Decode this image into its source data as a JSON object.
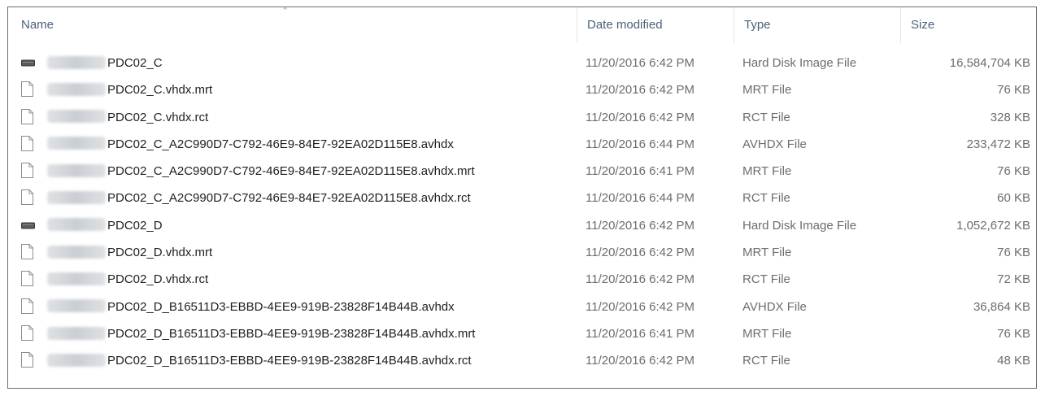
{
  "columns": {
    "name": "Name",
    "date": "Date modified",
    "type": "Type",
    "size": "Size"
  },
  "files": [
    {
      "icon": "hard-disk-icon",
      "name": "PDC02_C",
      "date": "11/20/2016 6:42 PM",
      "type": "Hard Disk Image File",
      "size": "16,584,704 KB"
    },
    {
      "icon": "document-icon",
      "name": "PDC02_C.vhdx.mrt",
      "date": "11/20/2016 6:42 PM",
      "type": "MRT File",
      "size": "76 KB"
    },
    {
      "icon": "document-icon",
      "name": "PDC02_C.vhdx.rct",
      "date": "11/20/2016 6:42 PM",
      "type": "RCT File",
      "size": "328 KB"
    },
    {
      "icon": "document-icon",
      "name": "PDC02_C_A2C990D7-C792-46E9-84E7-92EA02D115E8.avhdx",
      "date": "11/20/2016 6:44 PM",
      "type": "AVHDX File",
      "size": "233,472 KB"
    },
    {
      "icon": "document-icon",
      "name": "PDC02_C_A2C990D7-C792-46E9-84E7-92EA02D115E8.avhdx.mrt",
      "date": "11/20/2016 6:41 PM",
      "type": "MRT File",
      "size": "76 KB"
    },
    {
      "icon": "document-icon",
      "name": "PDC02_C_A2C990D7-C792-46E9-84E7-92EA02D115E8.avhdx.rct",
      "date": "11/20/2016 6:44 PM",
      "type": "RCT File",
      "size": "60 KB"
    },
    {
      "icon": "hard-disk-icon",
      "name": "PDC02_D",
      "date": "11/20/2016 6:42 PM",
      "type": "Hard Disk Image File",
      "size": "1,052,672 KB"
    },
    {
      "icon": "document-icon",
      "name": "PDC02_D.vhdx.mrt",
      "date": "11/20/2016 6:42 PM",
      "type": "MRT File",
      "size": "76 KB"
    },
    {
      "icon": "document-icon",
      "name": "PDC02_D.vhdx.rct",
      "date": "11/20/2016 6:42 PM",
      "type": "RCT File",
      "size": "72 KB"
    },
    {
      "icon": "document-icon",
      "name": "PDC02_D_B16511D3-EBBD-4EE9-919B-23828F14B44B.avhdx",
      "date": "11/20/2016 6:42 PM",
      "type": "AVHDX File",
      "size": "36,864 KB"
    },
    {
      "icon": "document-icon",
      "name": "PDC02_D_B16511D3-EBBD-4EE9-919B-23828F14B44B.avhdx.mrt",
      "date": "11/20/2016 6:41 PM",
      "type": "MRT File",
      "size": "76 KB"
    },
    {
      "icon": "document-icon",
      "name": "PDC02_D_B16511D3-EBBD-4EE9-919B-23828F14B44B.avhdx.rct",
      "date": "11/20/2016 6:42 PM",
      "type": "RCT File",
      "size": "48 KB"
    }
  ],
  "colors": {
    "header_text": "#4c607a",
    "secondary_text": "#6d6d6d",
    "border": "#6d6d6d"
  }
}
